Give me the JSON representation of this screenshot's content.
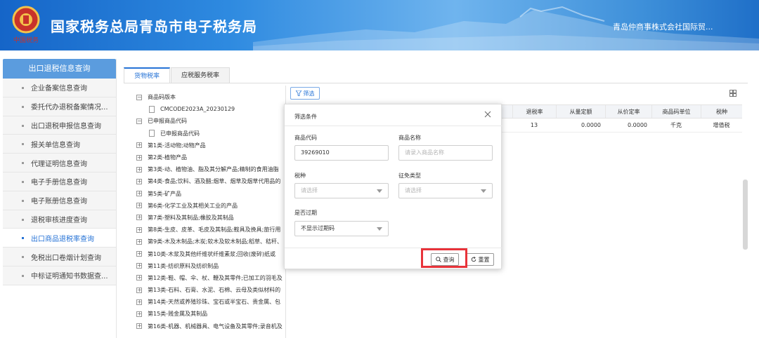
{
  "header": {
    "title": "国家税务总局青岛市电子税务局",
    "company": "青岛仲商事株式会社国际贸..."
  },
  "sidebar": {
    "heading": "出口退税信息查询",
    "items": [
      {
        "label": "企业备案信息查询",
        "active": false
      },
      {
        "label": "委托代办退税备案情况...",
        "active": false
      },
      {
        "label": "出口退税申报信息查询",
        "active": false
      },
      {
        "label": "报关单信息查询",
        "active": false
      },
      {
        "label": "代理证明信息查询",
        "active": false
      },
      {
        "label": "电子手册信息查询",
        "active": false
      },
      {
        "label": "电子账册信息查询",
        "active": false
      },
      {
        "label": "退税审核进度查询",
        "active": false
      },
      {
        "label": "出口商品退税率查询",
        "active": true
      },
      {
        "label": "免税出口卷烟计划查询",
        "active": false
      },
      {
        "label": "中标证明通知书数据查...",
        "active": false
      }
    ]
  },
  "tabs": [
    {
      "label": "货物税率",
      "active": true
    },
    {
      "label": "应税服务税率",
      "active": false
    }
  ],
  "tree": [
    {
      "label": "商品码版本",
      "level": 2,
      "toggle": "−"
    },
    {
      "label": "CMCODE2023A_20230129",
      "level": 1,
      "toggle": "file"
    },
    {
      "label": "已申报商品代码",
      "level": 2,
      "toggle": "−"
    },
    {
      "label": "已申报商品代码",
      "level": 1,
      "toggle": "file"
    },
    {
      "label": "第1类-活动物;动物产品",
      "level": 2,
      "toggle": "+"
    },
    {
      "label": "第2类-植物产品",
      "level": 2,
      "toggle": "+"
    },
    {
      "label": "第3类-动、植物油、脂及其分解产品;精制的食用油脂",
      "level": 2,
      "toggle": "+"
    },
    {
      "label": "第4类-食品;饮料、酒及醋;烟草、烟草及烟草代用品的",
      "level": 2,
      "toggle": "+"
    },
    {
      "label": "第5类-矿产品",
      "level": 2,
      "toggle": "+"
    },
    {
      "label": "第6类-化学工业及其相关工业的产品",
      "level": 2,
      "toggle": "+"
    },
    {
      "label": "第7类-塑料及其制品;橡胶及其制品",
      "level": 2,
      "toggle": "+"
    },
    {
      "label": "第8类-生皮、皮革、毛皮及其制品;鞍具及挽具;旅行用",
      "level": 2,
      "toggle": "+"
    },
    {
      "label": "第9类-木及木制品;木炭;软木及软木制品;稻草、秸秆、",
      "level": 2,
      "toggle": "+"
    },
    {
      "label": "第10类-木浆及其他纤维状纤维素浆;回收(废碎)纸或",
      "level": 2,
      "toggle": "+"
    },
    {
      "label": "第11类-纺织原料及纺织制品",
      "level": 2,
      "toggle": "+"
    },
    {
      "label": "第12类-鞋、帽、伞、杖、鞭及其零件;已加工的羽毛及",
      "level": 2,
      "toggle": "+"
    },
    {
      "label": "第13类-石料、石膏、水泥、石棉、云母及类似材料的",
      "level": 2,
      "toggle": "+"
    },
    {
      "label": "第14类-天然或养殖珍珠、宝石或半宝石、贵金属、包",
      "level": 2,
      "toggle": "+"
    },
    {
      "label": "第15类-贱金属及其制品",
      "level": 2,
      "toggle": "+"
    },
    {
      "label": "第16类-机器、机械器具、电气设备及其零件;录音机及",
      "level": 2,
      "toggle": "+"
    }
  ],
  "toolbar": {
    "filter_label": "筛选"
  },
  "table": {
    "columns": [
      "退税率",
      "从量定额",
      "从价定率",
      "商品码单位",
      "税种"
    ],
    "rows": [
      [
        "13",
        "0.0000",
        "0.0000",
        "千克",
        "增值税"
      ]
    ]
  },
  "modal": {
    "title": "筛选条件",
    "fields": {
      "code_label": "商品代码",
      "code_value": "39269010",
      "name_label": "商品名称",
      "name_placeholder": "请录入商品名称",
      "tax_label": "税种",
      "tax_placeholder": "请选择",
      "exempt_label": "征免类型",
      "exempt_placeholder": "请选择",
      "expired_label": "是否过期",
      "expired_value": "不显示过期码"
    },
    "query_label": "查询",
    "reset_label": "重置"
  },
  "colors": {
    "primary": "#2673d6",
    "highlight": "#e8333a",
    "sidebar_head": "#5b9cde"
  }
}
